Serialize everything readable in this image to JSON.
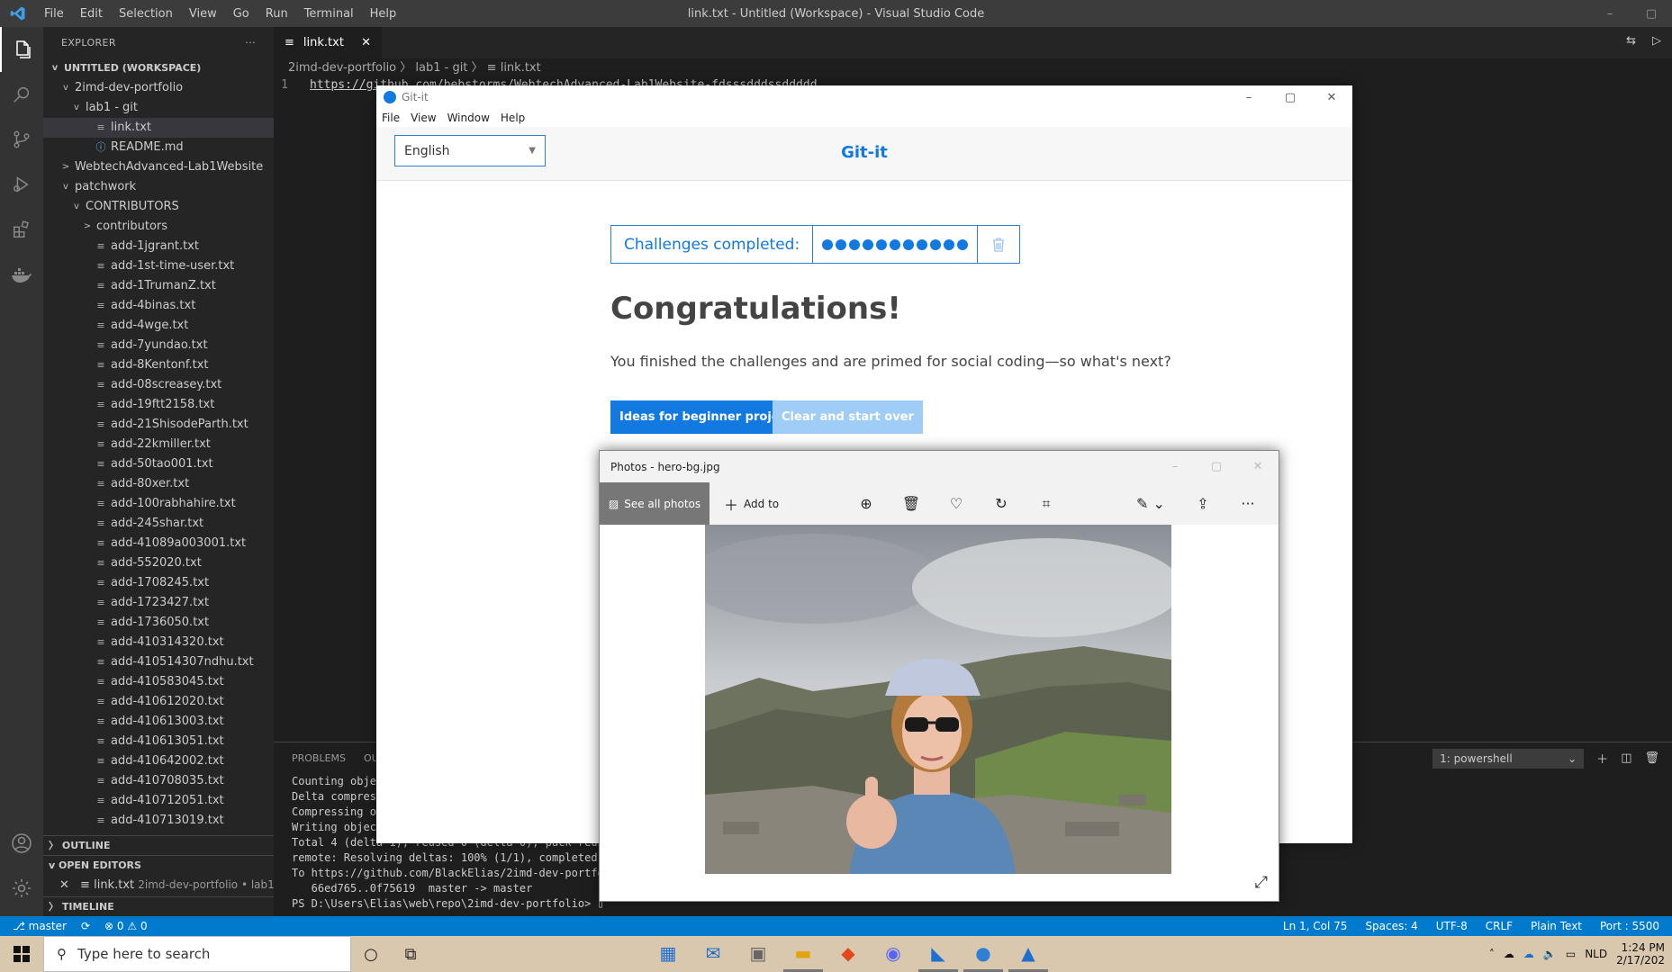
{
  "vscode": {
    "window_title": "link.txt - Untitled (Workspace) - Visual Studio Code",
    "menu": [
      "File",
      "Edit",
      "Selection",
      "View",
      "Go",
      "Run",
      "Terminal",
      "Help"
    ],
    "explorer_title": "EXPLORER",
    "explorer_more": "···",
    "tree": [
      {
        "indent": 0,
        "tw": "v",
        "icon": "",
        "label": "UNTITLED (WORKSPACE)",
        "section": true
      },
      {
        "indent": 1,
        "tw": "v",
        "icon": "",
        "label": "2imd-dev-portfolio"
      },
      {
        "indent": 2,
        "tw": "v",
        "icon": "",
        "label": "lab1 - git"
      },
      {
        "indent": 3,
        "tw": "",
        "icon": "≡",
        "label": "link.txt",
        "selected": true
      },
      {
        "indent": 3,
        "tw": "",
        "icon": "ⓘ",
        "label": "README.md",
        "info": true
      },
      {
        "indent": 1,
        "tw": ">",
        "icon": "",
        "label": "WebtechAdvanced-Lab1Website"
      },
      {
        "indent": 1,
        "tw": "v",
        "icon": "",
        "label": "patchwork"
      },
      {
        "indent": 2,
        "tw": "v",
        "icon": "",
        "label": "CONTRIBUTORS"
      },
      {
        "indent": 3,
        "tw": ">",
        "icon": "",
        "label": "contributors"
      },
      {
        "indent": 3,
        "tw": "",
        "icon": "≡",
        "label": "add-1jgrant.txt"
      },
      {
        "indent": 3,
        "tw": "",
        "icon": "≡",
        "label": "add-1st-time-user.txt"
      },
      {
        "indent": 3,
        "tw": "",
        "icon": "≡",
        "label": "add-1TrumanZ.txt"
      },
      {
        "indent": 3,
        "tw": "",
        "icon": "≡",
        "label": "add-4binas.txt"
      },
      {
        "indent": 3,
        "tw": "",
        "icon": "≡",
        "label": "add-4wge.txt"
      },
      {
        "indent": 3,
        "tw": "",
        "icon": "≡",
        "label": "add-7yundao.txt"
      },
      {
        "indent": 3,
        "tw": "",
        "icon": "≡",
        "label": "add-8Kentonf.txt"
      },
      {
        "indent": 3,
        "tw": "",
        "icon": "≡",
        "label": "add-08screasey.txt"
      },
      {
        "indent": 3,
        "tw": "",
        "icon": "≡",
        "label": "add-19ftt2158.txt"
      },
      {
        "indent": 3,
        "tw": "",
        "icon": "≡",
        "label": "add-21ShisodeParth.txt"
      },
      {
        "indent": 3,
        "tw": "",
        "icon": "≡",
        "label": "add-22kmiller.txt"
      },
      {
        "indent": 3,
        "tw": "",
        "icon": "≡",
        "label": "add-50tao001.txt"
      },
      {
        "indent": 3,
        "tw": "",
        "icon": "≡",
        "label": "add-80xer.txt"
      },
      {
        "indent": 3,
        "tw": "",
        "icon": "≡",
        "label": "add-100rabhahire.txt"
      },
      {
        "indent": 3,
        "tw": "",
        "icon": "≡",
        "label": "add-245shar.txt"
      },
      {
        "indent": 3,
        "tw": "",
        "icon": "≡",
        "label": "add-41089a003001.txt"
      },
      {
        "indent": 3,
        "tw": "",
        "icon": "≡",
        "label": "add-552020.txt"
      },
      {
        "indent": 3,
        "tw": "",
        "icon": "≡",
        "label": "add-1708245.txt"
      },
      {
        "indent": 3,
        "tw": "",
        "icon": "≡",
        "label": "add-1723427.txt"
      },
      {
        "indent": 3,
        "tw": "",
        "icon": "≡",
        "label": "add-1736050.txt"
      },
      {
        "indent": 3,
        "tw": "",
        "icon": "≡",
        "label": "add-410314320.txt"
      },
      {
        "indent": 3,
        "tw": "",
        "icon": "≡",
        "label": "add-410514307ndhu.txt"
      },
      {
        "indent": 3,
        "tw": "",
        "icon": "≡",
        "label": "add-410583045.txt"
      },
      {
        "indent": 3,
        "tw": "",
        "icon": "≡",
        "label": "add-410612020.txt"
      },
      {
        "indent": 3,
        "tw": "",
        "icon": "≡",
        "label": "add-410613003.txt"
      },
      {
        "indent": 3,
        "tw": "",
        "icon": "≡",
        "label": "add-410613051.txt"
      },
      {
        "indent": 3,
        "tw": "",
        "icon": "≡",
        "label": "add-410642002.txt"
      },
      {
        "indent": 3,
        "tw": "",
        "icon": "≡",
        "label": "add-410708035.txt"
      },
      {
        "indent": 3,
        "tw": "",
        "icon": "≡",
        "label": "add-410712051.txt"
      },
      {
        "indent": 3,
        "tw": "",
        "icon": "≡",
        "label": "add-410713019.txt"
      }
    ],
    "outline_label": "OUTLINE",
    "open_editors_label": "OPEN EDITORS",
    "open_editor_item": "link.txt",
    "open_editor_path": "2imd-dev-portfolio • lab1 - ...",
    "timeline_label": "TIMELINE",
    "tab_label": "link.txt",
    "breadcrumb": "2imd-dev-portfolio 〉 lab1 - git 〉 ≡ link.txt",
    "line_number": "1",
    "line_text": "https://github.com/bebstorms/WebtechAdvanced-Lab1Website-fdsssdddssddddd",
    "panel_tabs": [
      "PROBLEMS",
      "OUT"
    ],
    "terminal_select": "1: powershell",
    "terminal_lines": [
      "Counting objec",
      "Delta compress",
      "Compressing ob",
      "Writing object",
      "Total 4 (delta 1), reused 0 (delta 0), pack-reuse",
      "remote: Resolving deltas: 100% (1/1), completed w",
      "To https://github.com/BlackElias/2imd-dev-portfol",
      "   66ed765..0f75619  master -> master",
      "PS D:\\Users\\Elias\\web\\repo\\2imd-dev-portfolio> ▯"
    ],
    "status_branch": "master",
    "status_errors": "⊗ 0 ⚠ 0",
    "status_right": [
      "Ln 1, Col 75",
      "Spaces: 4",
      "UTF-8",
      "CRLF",
      "Plain Text",
      "Port : 5500"
    ]
  },
  "gitit": {
    "title": "Git-it",
    "menu": [
      "File",
      "View",
      "Window",
      "Help"
    ],
    "language": "English",
    "brand": "Git-it",
    "challenges_label": "Challenges completed:",
    "challenges_done": 11,
    "heading": "Congratulations!",
    "message": "You finished the challenges and are primed for social coding—so what's next?",
    "primary_button": "Ideas for beginner projects",
    "secondary_button": "Clear and start over"
  },
  "photos": {
    "title": "Photos - hero-bg.jpg",
    "see_all": "See all photos",
    "add_to": "Add to"
  },
  "taskbar": {
    "search_placeholder": "Type here to search",
    "lang": "NLD",
    "time": "1:24 PM",
    "date": "2/17/202"
  }
}
